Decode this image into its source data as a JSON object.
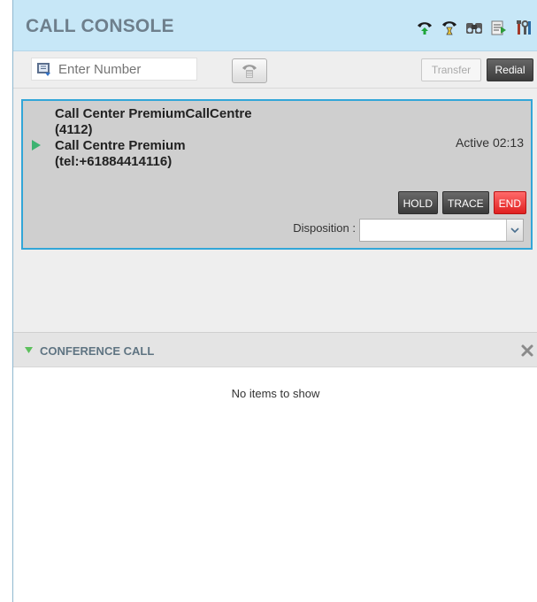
{
  "header": {
    "title": "CALL CONSOLE",
    "icons": [
      "answer-call-icon",
      "hold-phone-icon",
      "directory-icon",
      "call-log-icon",
      "settings-icon"
    ]
  },
  "toolbar": {
    "number_placeholder": "Enter Number",
    "transfer_label": "Transfer",
    "redial_label": "Redial"
  },
  "active_call": {
    "caller_line1": "Call Center PremiumCallCentre",
    "caller_line2": "(4112)",
    "caller_line3": "Call Centre Premium",
    "caller_line4": "(tel:+61884414116)",
    "status": "Active 02:13",
    "hold_label": "HOLD",
    "trace_label": "TRACE",
    "end_label": "END",
    "disposition_label": "Disposition :",
    "disposition_value": ""
  },
  "conference": {
    "title": "CONFERENCE CALL",
    "empty_message": "No items to show"
  },
  "colors": {
    "header_bg": "#c7e7f7",
    "card_border": "#32a6d8",
    "end_button": "#e02020",
    "play_icon": "#3cb371"
  }
}
